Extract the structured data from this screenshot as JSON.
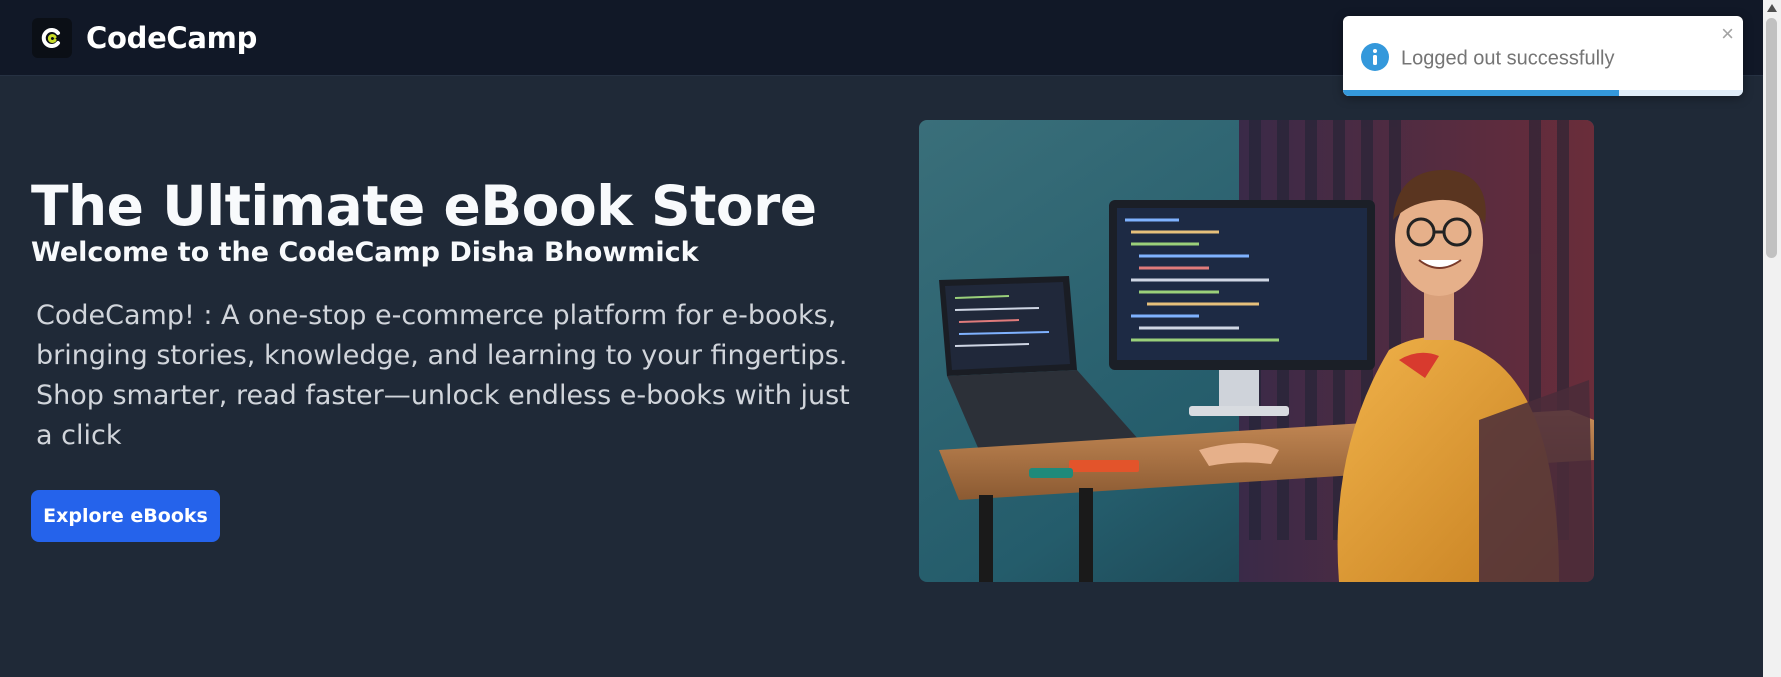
{
  "navbar": {
    "brand_name": "CodeCamp",
    "logo_icon": "codecamp-logo-icon"
  },
  "hero": {
    "title": "The Ultimate eBook Store",
    "subtitle": "Welcome to the CodeCamp Disha Bhowmick",
    "description": "CodeCamp! : A one-stop e-commerce platform for e-books, bringing stories, knowledge, and learning to your fingertips. Shop smarter, read faster—unlock endless e-books with just a click",
    "cta_label": "Explore eBooks",
    "image_icon": "hero-photo"
  },
  "toast": {
    "message": "Logged out successfully",
    "close_symbol": "×",
    "icon": "info-icon",
    "progress": 0.69,
    "colors": {
      "info": "#3498db",
      "text": "#757575"
    }
  },
  "colors": {
    "background": "#1f2937",
    "navbar": "#111827",
    "accent": "#2563eb"
  }
}
